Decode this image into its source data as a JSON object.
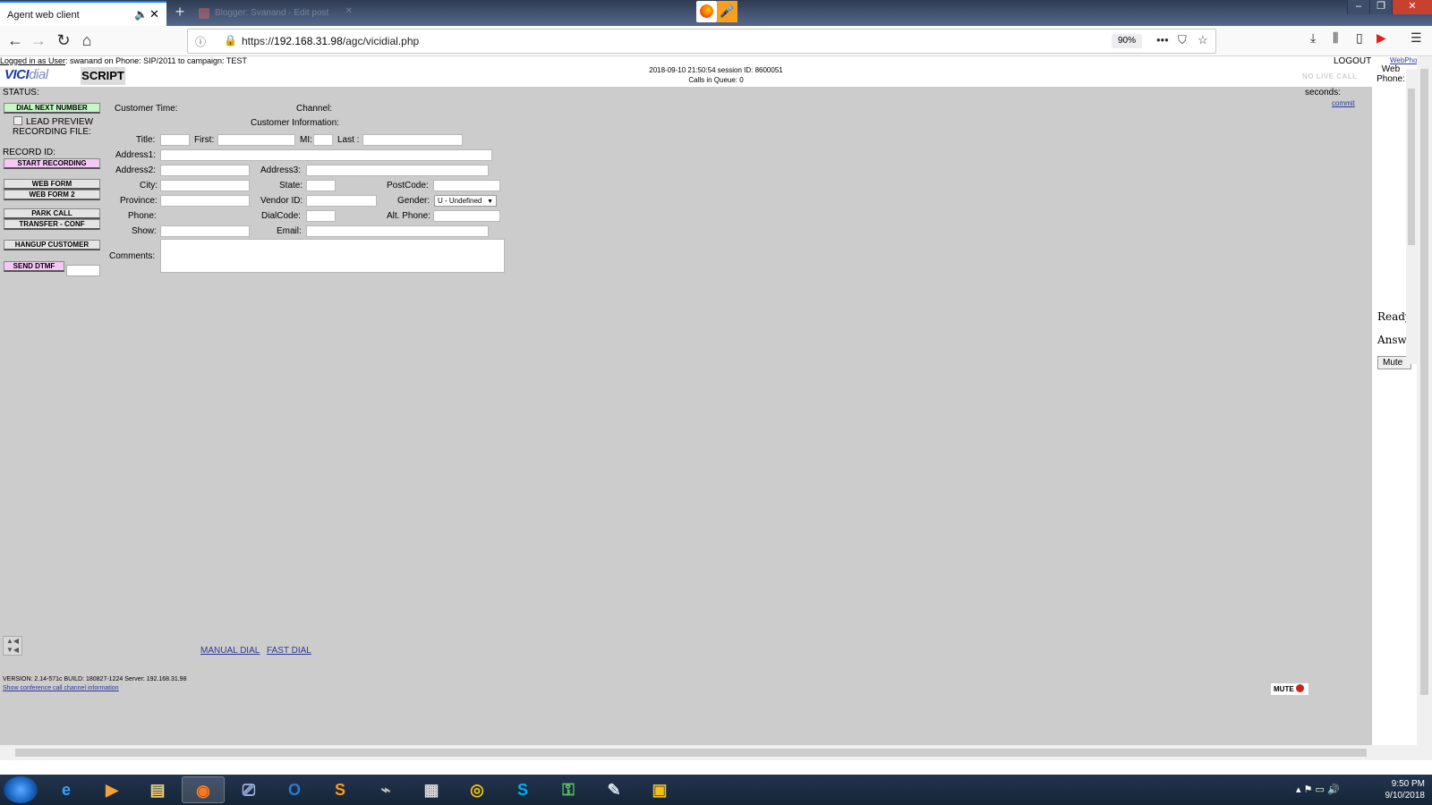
{
  "browser": {
    "active_tab_title": "Agent web client",
    "background_tab_title": "Blogger: Svanand - Edit post",
    "url_prefix": "https://",
    "url_host": "192.168.31.98",
    "url_path": "/agc/vicidial.php",
    "zoom": "90%"
  },
  "header": {
    "logged_in_prefix": "Logged in as User",
    "logged_in_text": ": swanand on Phone: SIP/2011  to campaign: TEST",
    "logo_vici": "VICI",
    "logo_dial": "dial",
    "script_tab": "SCRIPT",
    "datetime_session": "2018-09-10 21:50:54    session ID: 8600051",
    "calls_in_queue": "Calls in Queue: 0",
    "logout": "LOGOUT",
    "no_live_call": "NO LIVE CALL"
  },
  "left": {
    "status_label": "STATUS:",
    "dial_next": "DIAL NEXT NUMBER",
    "lead_preview": "LEAD PREVIEW",
    "recording_file": "RECORDING FILE:",
    "record_id": "RECORD ID:",
    "start_recording": "START RECORDING",
    "web_form": "WEB FORM",
    "web_form_2": "WEB FORM 2",
    "park_call": "PARK CALL",
    "transfer_conf": "TRANSFER - CONF",
    "hangup_customer": "HANGUP CUSTOMER",
    "send_dtmf": "SEND DTMF"
  },
  "form": {
    "customer_time": "Customer Time:",
    "channel": "Channel:",
    "customer_information": "Customer Information:",
    "title": "Title:",
    "first": "First:",
    "mi": "MI:",
    "last": "Last :",
    "address1": "Address1:",
    "address2": "Address2:",
    "address3": "Address3:",
    "city": "City:",
    "state": "State:",
    "postcode": "PostCode:",
    "province": "Province:",
    "vendor_id": "Vendor ID:",
    "gender": "Gender:",
    "gender_value": "U - Undefined",
    "phone": "Phone:",
    "dialcode": "DialCode:",
    "alt_phone": "Alt. Phone:",
    "show": "Show:",
    "email": "Email:",
    "comments": "Comments:"
  },
  "footer": {
    "manual_dial": "MANUAL DIAL",
    "fast_dial": "FAST DIAL",
    "version": "VERSION: 2.14-571c   BUILD: 180827-1224     Server: 192.168.31.98",
    "conf_link": "Show conference call channel information",
    "mute": "MUTE"
  },
  "right": {
    "seconds": "seconds:",
    "commit": "commit",
    "webphone_link": "WebPho",
    "web_phone": "Web Phone:",
    "ready": "Ready",
    "answer": "Answe",
    "mute": "Mute"
  },
  "taskbar": {
    "time": "9:50 PM",
    "date": "9/10/2018"
  }
}
